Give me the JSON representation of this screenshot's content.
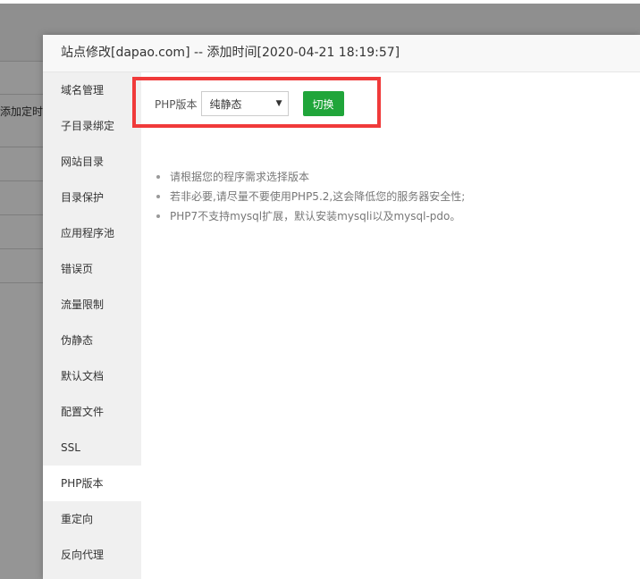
{
  "background": {
    "partial_text": "添加定时"
  },
  "modal": {
    "title": "站点修改[dapao.com] -- 添加时间[2020-04-21 18:19:57]"
  },
  "sidebar": {
    "items": [
      {
        "label": "域名管理"
      },
      {
        "label": "子目录绑定"
      },
      {
        "label": "网站目录"
      },
      {
        "label": "目录保护"
      },
      {
        "label": "应用程序池"
      },
      {
        "label": "错误页"
      },
      {
        "label": "流量限制"
      },
      {
        "label": "伪静态"
      },
      {
        "label": "默认文档"
      },
      {
        "label": "配置文件"
      },
      {
        "label": "SSL"
      },
      {
        "label": "PHP版本"
      },
      {
        "label": "重定向"
      },
      {
        "label": "反向代理"
      }
    ],
    "active": "PHP版本"
  },
  "php_version": {
    "label": "PHP版本",
    "selected": "纯静态",
    "caret_icon": "caret-down-icon",
    "switch_label": "切换",
    "accent_color": "#20a53a",
    "highlight_color": "#f03a3a"
  },
  "tips": [
    "请根据您的程序需求选择版本",
    "若非必要,请尽量不要使用PHP5.2,这会降低您的服务器安全性;",
    "PHP7不支持mysql扩展，默认安装mysqli以及mysql-pdo。"
  ]
}
